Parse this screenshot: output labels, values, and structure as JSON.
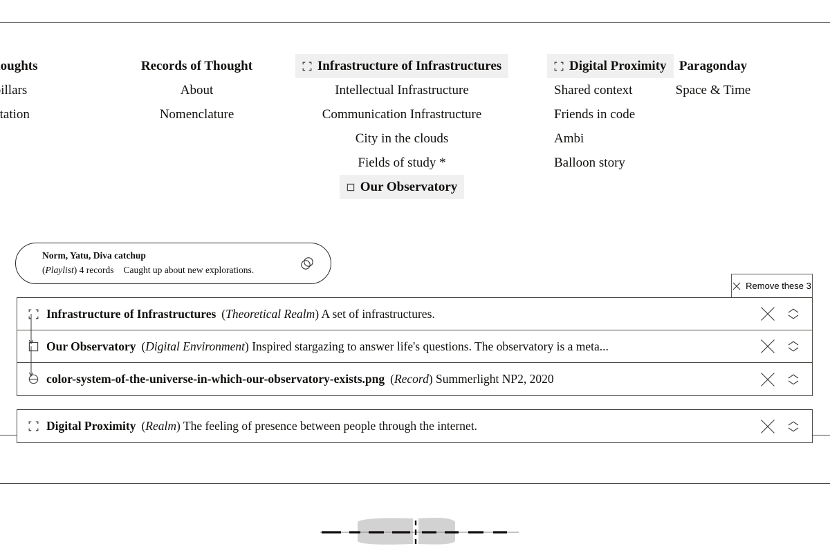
{
  "nav": {
    "columns": [
      {
        "id": "system-for-thoughts",
        "header": {
          "label": "m for Thoughts",
          "icon": "none",
          "highlighted": false
        },
        "items": [
          {
            "label": "tional pillars",
            "icon": "none",
            "highlighted": false
          },
          {
            "label": "of facilitation",
            "icon": "none",
            "highlighted": false
          }
        ]
      },
      {
        "id": "records-of-thought",
        "header": {
          "label": "Records of Thought",
          "icon": "none",
          "highlighted": false
        },
        "items": [
          {
            "label": "About",
            "icon": "none",
            "highlighted": false
          },
          {
            "label": "Nomenclature",
            "icon": "none",
            "highlighted": false
          }
        ]
      },
      {
        "id": "infrastructure-of-infrastructures",
        "header": {
          "label": "Infrastructure of Infrastructures",
          "icon": "realm-frame-icon",
          "highlighted": true
        },
        "items": [
          {
            "label": "Intellectual Infrastructure",
            "icon": "none",
            "highlighted": false
          },
          {
            "label": "Communication Infrastructure",
            "icon": "none",
            "highlighted": false
          },
          {
            "label": "City in the clouds",
            "icon": "none",
            "highlighted": false
          },
          {
            "label": "Fields of study *",
            "icon": "none",
            "highlighted": false
          },
          {
            "label": "Our Observatory",
            "icon": "environment-square-icon",
            "highlighted": true
          }
        ]
      },
      {
        "id": "digital-proximity",
        "header": {
          "label": "Digital Proximity",
          "icon": "realm-frame-icon",
          "highlighted": true
        },
        "items": [
          {
            "label": "Shared context",
            "icon": "none",
            "highlighted": false
          },
          {
            "label": "Friends in code",
            "icon": "none",
            "highlighted": false
          },
          {
            "label": "Ambi",
            "icon": "none",
            "highlighted": false
          },
          {
            "label": "Balloon story",
            "icon": "none",
            "highlighted": false
          }
        ]
      },
      {
        "id": "paragonday",
        "header": {
          "label": "Paragonday",
          "icon": "none",
          "highlighted": false
        },
        "items": [
          {
            "label": "Space & Time",
            "icon": "none",
            "highlighted": false
          }
        ]
      }
    ]
  },
  "playlist": {
    "title": "Norm, Yatu, Diva catchup",
    "kind": "Playlist",
    "kind_open": "(",
    "kind_close": ")",
    "count": "4 records",
    "note": "Caught up about new explorations.",
    "icon": "playlist-rings-icon"
  },
  "toolbar": {
    "remove_label": "Remove these 3",
    "remove_icon": "close-x-icon"
  },
  "results": {
    "groups": [
      {
        "id": "group-observatory",
        "rows": [
          {
            "icon": "realm-frame-icon",
            "title": "Infrastructure of Infrastructures",
            "kind_open": "(",
            "kind": "Theoretical Realm",
            "kind_close": ")",
            "description": "A set of infrastructures.",
            "connector_below": true
          },
          {
            "icon": "environment-square-icon",
            "title": "Our Observatory",
            "kind_open": "(",
            "kind": "Digital Environment",
            "kind_close": ")",
            "description": "Inspired stargazing to answer life's questions. The observatory is a meta...",
            "connector_below": true
          },
          {
            "icon": "record-disc-icon",
            "title": "color-system-of-the-universe-in-which-our-observatory-exists.png",
            "kind_open": "(",
            "kind": "Record",
            "kind_close": ")",
            "description": "Summerlight NP2, 2020",
            "connector_below": false
          }
        ]
      },
      {
        "id": "group-digital-proximity",
        "rows": [
          {
            "icon": "realm-frame-icon",
            "title": "Digital Proximity",
            "kind_open": "(",
            "kind": "Realm",
            "kind_close": ")",
            "description": "The feeling of presence between people through the internet.",
            "connector_below": false
          }
        ]
      }
    ],
    "row_actions": {
      "remove_icon": "close-x-icon",
      "reorder_icon": "chevron-up-down-icon"
    }
  },
  "timeline": {
    "icon": "dashed-timeline-icon"
  },
  "colors": {
    "text": "#12100e",
    "rule": "#4a4744",
    "rule_light": "#6f6c69",
    "chip_bg": "#f0f0f0",
    "timeline_blob": "#d2d2d2"
  }
}
